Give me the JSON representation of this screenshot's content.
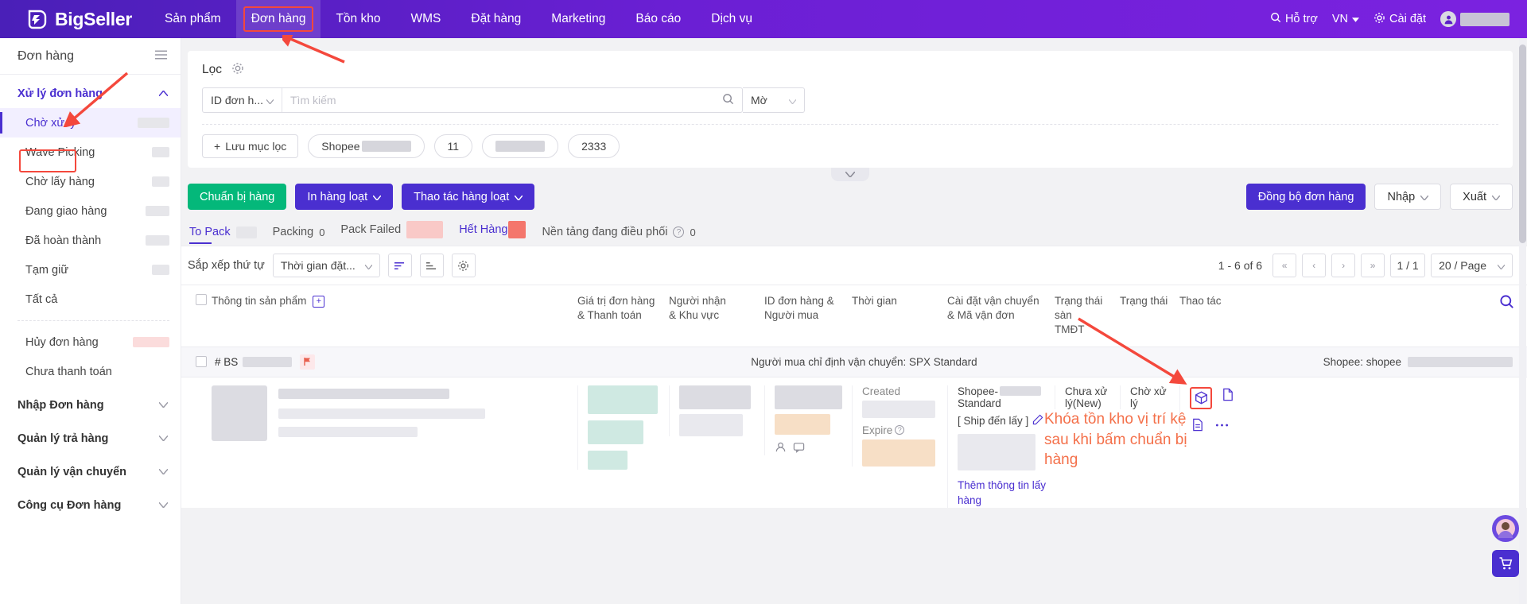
{
  "topnav": {
    "brand": "BigSeller",
    "items": [
      {
        "label": "Sản phẩm",
        "active": false
      },
      {
        "label": "Đơn hàng",
        "active": true
      },
      {
        "label": "Tồn kho",
        "active": false
      },
      {
        "label": "WMS",
        "active": false
      },
      {
        "label": "Đặt hàng",
        "active": false
      },
      {
        "label": "Marketing",
        "active": false
      },
      {
        "label": "Báo cáo",
        "active": false
      },
      {
        "label": "Dịch vụ",
        "active": false
      }
    ],
    "support": "Hỗ trợ",
    "lang": "VN",
    "settings": "Cài đặt"
  },
  "sidebar": {
    "title": "Đơn hàng",
    "group1": "Xử lý đơn hàng",
    "items": [
      {
        "label": "Chờ xử lý",
        "active": true
      },
      {
        "label": "Wave Picking",
        "active": false
      },
      {
        "label": "Chờ lấy hàng",
        "active": false
      },
      {
        "label": "Đang giao hàng",
        "active": false
      },
      {
        "label": "Đã hoàn thành",
        "active": false
      },
      {
        "label": "Tạm giữ",
        "active": false
      },
      {
        "label": "Tất cả",
        "active": false
      }
    ],
    "items2": [
      {
        "label": "Hủy đơn hàng"
      },
      {
        "label": "Chưa thanh toán"
      }
    ],
    "groups": [
      {
        "label": "Nhập Đơn hàng"
      },
      {
        "label": "Quản lý trả hàng"
      },
      {
        "label": "Quản lý vận chuyển"
      },
      {
        "label": "Công cụ Đơn hàng"
      }
    ]
  },
  "filter": {
    "title": "Lọc",
    "field_select": "ID đơn h...",
    "search_placeholder": "Tìm kiếm",
    "mode": "Mờ",
    "save_chip": "Lưu mục lọc",
    "chips": [
      {
        "label": "Shopee",
        "blurred": true
      },
      {
        "label": "11",
        "blurred": false
      },
      {
        "label": "",
        "blurred": true
      },
      {
        "label": "2333",
        "blurred": false
      }
    ]
  },
  "actions": {
    "prepare": "Chuẩn bị hàng",
    "print_bulk": "In hàng loạt",
    "bulk_ops": "Thao tác hàng loạt",
    "sync": "Đồng bộ đơn hàng",
    "import": "Nhập",
    "export": "Xuất"
  },
  "tabs": [
    {
      "label": "To Pack",
      "count": "",
      "active": true,
      "badge": "lav"
    },
    {
      "label": "Packing",
      "count": "0",
      "active": false,
      "badge": "none"
    },
    {
      "label": "Pack Failed",
      "count": "",
      "active": false,
      "badge": "pk"
    },
    {
      "label": "Hết Hàng",
      "count": "",
      "active": false,
      "badge": "red"
    },
    {
      "label": "Nền tảng đang điều phối",
      "count": "0",
      "active": false,
      "badge": "info"
    }
  ],
  "sortbar": {
    "label": "Sắp xếp thứ tự",
    "sort_value": "Thời gian đặt...",
    "range": "1 - 6 of 6",
    "page": "1 / 1",
    "page_size": "20 / Page"
  },
  "table": {
    "columns": [
      {
        "label": "Thông tin sản phẩm"
      },
      {
        "label": "Giá trị đơn hàng\n& Thanh toán"
      },
      {
        "label": "Người nhận\n& Khu vực"
      },
      {
        "label": "ID đơn hàng &\nNgười mua"
      },
      {
        "label": "Thời gian"
      },
      {
        "label": "Cài đặt vận chuyển\n& Mã vận đơn"
      },
      {
        "label": "Trạng thái sàn\nTMĐT"
      },
      {
        "label": "Trạng thái"
      },
      {
        "label": "Thao tác"
      }
    ],
    "col_product": "Thông tin sản phẩm",
    "col_value_l1": "Giá trị đơn hàng",
    "col_value_l2": "& Thanh toán",
    "col_recv_l1": "Người nhận",
    "col_recv_l2": "& Khu vực",
    "col_id_l1": "ID đơn hàng &",
    "col_id_l2": "Người mua",
    "col_time": "Thời gian",
    "col_ship_l1": "Cài đặt vận chuyển",
    "col_ship_l2": "& Mã vận đơn",
    "col_tmdt_l1": "Trạng thái sàn",
    "col_tmdt_l2": "TMĐT",
    "col_status": "Trạng thái",
    "col_action": "Thao tác"
  },
  "row": {
    "order_prefix": "# BS",
    "shipping_note": "Người mua chỉ định vận chuyển: SPX Standard",
    "shop_label": "Shopee: shopee",
    "time_created": "Created",
    "time_expire": "Expire",
    "ship_line1": "Shopee-",
    "ship_line2": "Standard",
    "ship_tag": "[ Ship đến lấy ]",
    "ship_link": "Thêm thông tin lấy hàng",
    "tmdt_l1": "Chưa xử",
    "tmdt_l2": "lý(New)",
    "status": "Chờ xử lý"
  },
  "annotations": {
    "note": "Khóa tồn kho vị trí kệ sau khi bấm chuẩn bị hàng",
    "note_line1": "Khóa tồn kho vị trí kệ",
    "note_line2": "sau khi bấm chuẩn bị",
    "note_line3": "hàng",
    "color": "#f4704a",
    "box_color": "#f4483c"
  },
  "icons": {
    "search": "search-icon",
    "gear": "gear-icon",
    "chevron_down": "chevron-down-icon",
    "flag": "flag-icon",
    "package": "package-icon",
    "document": "document-icon",
    "note": "note-icon",
    "more": "more-icon",
    "chat": "chat-icon",
    "cart": "cart-icon"
  }
}
